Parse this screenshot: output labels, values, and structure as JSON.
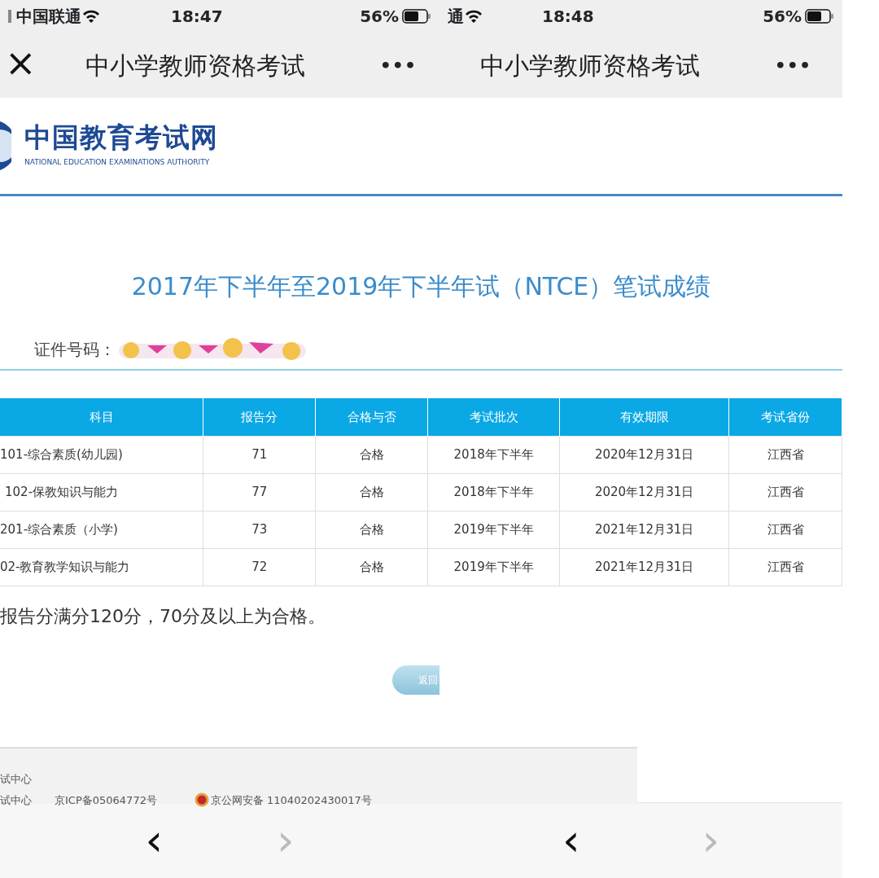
{
  "status_bars": [
    {
      "carrier": "中国联通",
      "time": "18:47",
      "battery": "56%"
    },
    {
      "carrier": "通",
      "time": "18:48",
      "battery": "56%"
    }
  ],
  "nav_bars": [
    {
      "close": "×",
      "title": "中小学教师资格考试",
      "more": "•••"
    },
    {
      "title": "中小学教师资格考试",
      "more": "•••"
    }
  ],
  "logo": {
    "name": "中国教育考试网",
    "subtitle": "NATIONAL EDUCATION EXAMINATIONS AUTHORITY"
  },
  "heading": "2017年下半年至2019年下半年试（NTCE）笔试成绩",
  "id_label": "证件号码：",
  "table": {
    "columns": [
      "科目",
      "报告分",
      "合格与否",
      "考试批次",
      "有效期限",
      "考试省份"
    ],
    "rows": [
      [
        "101-综合素质(幼儿园)",
        "71",
        "合格",
        "2018年下半年",
        "2020年12月31日",
        "江西省"
      ],
      [
        "102-保教知识与能力",
        "77",
        "合格",
        "2018年下半年",
        "2020年12月31日",
        "江西省"
      ],
      [
        "201-综合素质（小学)",
        "73",
        "合格",
        "2019年下半年",
        "2021年12月31日",
        "江西省"
      ],
      [
        "02-教育教学知识与能力",
        "72",
        "合格",
        "2019年下半年",
        "2021年12月31日",
        "江西省"
      ]
    ]
  },
  "note": "报告分满分120分，70分及以上为合格。",
  "return_button": "返回",
  "footer": {
    "lines": [
      "试中心",
      "试中心"
    ],
    "icp": "京ICP备05064772号",
    "security": "京公网安备 11040202430017号"
  },
  "toolbars": [
    {
      "back": "‹",
      "forward": "›",
      "forward_disabled": true
    },
    {
      "back": "‹",
      "forward": "›",
      "forward_disabled": true
    }
  ]
}
